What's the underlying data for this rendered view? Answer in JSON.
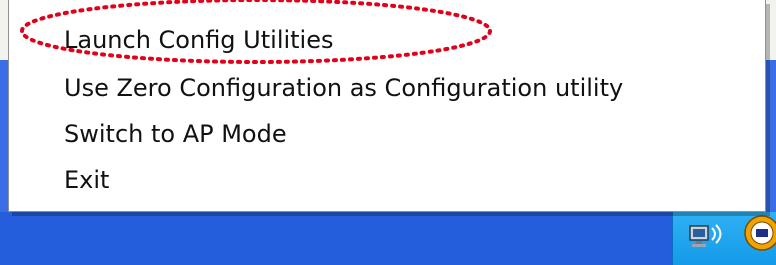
{
  "context_menu": {
    "items": [
      {
        "label": "Launch Config Utilities"
      },
      {
        "label": "Use Zero Configuration as Configuration utility"
      },
      {
        "label": "Switch to AP Mode"
      },
      {
        "label": "Exit"
      }
    ]
  },
  "annotation": {
    "shape": "dotted-ellipse",
    "color": "#e0001a",
    "target": "Launch Config Utilities"
  },
  "taskbar": {
    "color": "#245edc",
    "tray_color": "#1aa3ef",
    "tray_icons": [
      "network-icon",
      "wireless-utility-icon"
    ]
  }
}
